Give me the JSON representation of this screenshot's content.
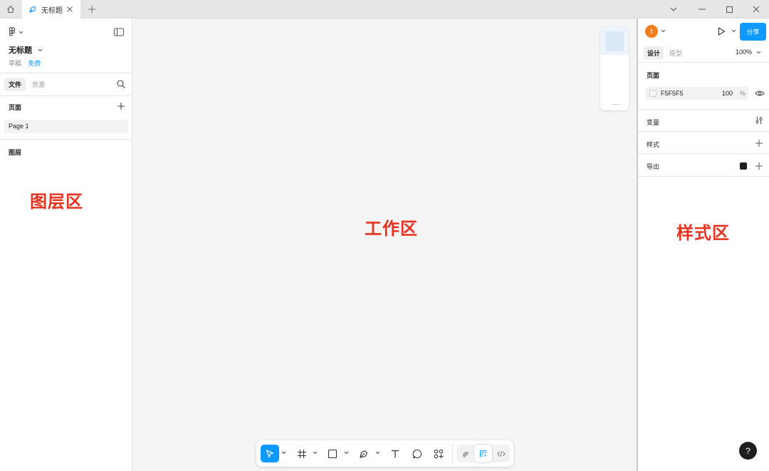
{
  "titlebar": {
    "tab_title": "无标题"
  },
  "left_panel": {
    "file_name": "无标题",
    "file_status": "草稿",
    "file_plan": "免费",
    "tabs": [
      {
        "label": "文件",
        "active": true
      },
      {
        "label": "资源",
        "active": false
      }
    ],
    "pages_label": "页面",
    "pages": [
      "Page 1"
    ],
    "layers_label": "图层",
    "annotation": "图层区"
  },
  "canvas": {
    "annotation": "工作区"
  },
  "right_panel": {
    "avatar_letter": "t",
    "share_label": "分享",
    "tabs": [
      {
        "label": "设计",
        "active": true
      },
      {
        "label": "原型",
        "active": false
      }
    ],
    "zoom": "100%",
    "page_section": "页面",
    "background_hex": "F5F5F5",
    "background_opacity": "100",
    "opacity_unit": "%",
    "variables_label": "变量",
    "styles_label": "样式",
    "export_label": "导出",
    "annotation": "样式区"
  },
  "toolbar": {
    "active_tool": "move",
    "active_mode": "design"
  },
  "help_label": "?",
  "colors": {
    "accent": "#0d99ff",
    "annotation": "#e8321d",
    "avatar": "#f07d1f"
  }
}
